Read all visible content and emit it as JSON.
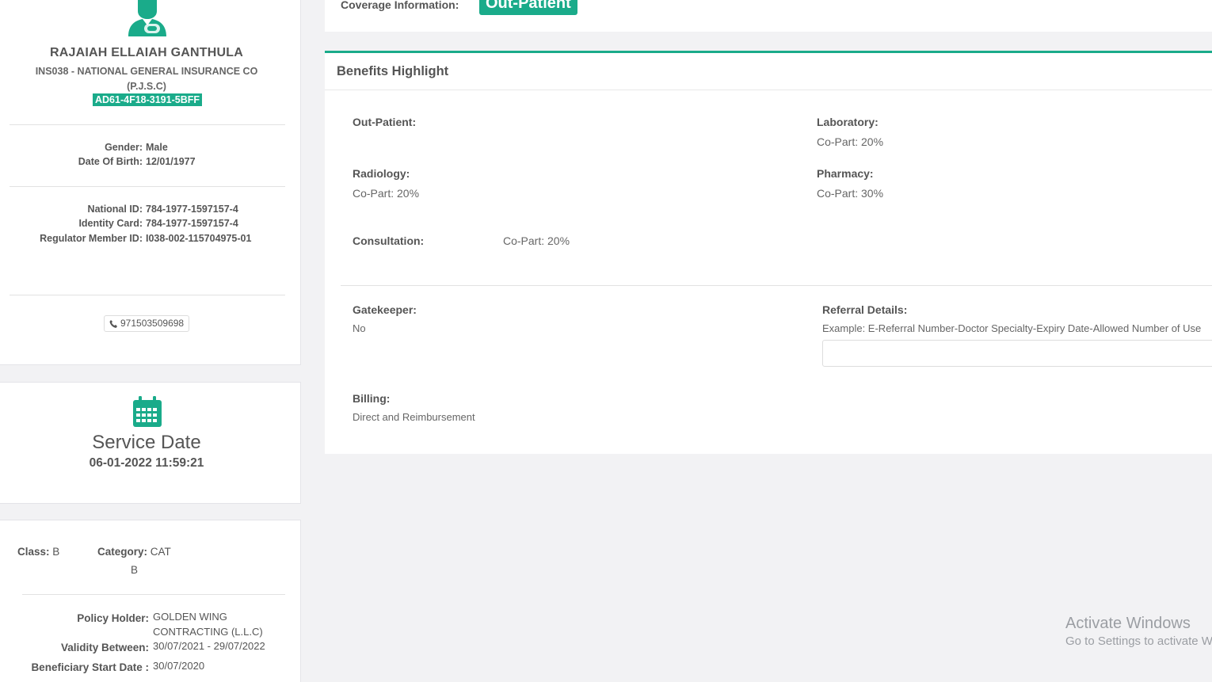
{
  "patient": {
    "avatar_icon": "user-avatar-icon",
    "name": "RAJAIAH ELLAIAH GANTHULA",
    "insurer": "INS038 - NATIONAL GENERAL INSURANCE CO (P.J.S.C)",
    "member_code": "AD61-4F18-3191-5BFF",
    "gender_label": "Gender:",
    "gender": "Male",
    "dob_label": "Date Of Birth:",
    "dob": "12/01/1977",
    "national_id_label": "National ID:",
    "national_id": "784-1977-1597157-4",
    "identity_card_label": "Identity Card:",
    "identity_card": "784-1977-1597157-4",
    "regulator_id_label": "Regulator Member ID:",
    "regulator_id": "I038-002-115704975-01",
    "phone_icon": "phone-icon",
    "phone": "971503509698"
  },
  "service": {
    "icon": "calendar-icon",
    "title": "Service Date",
    "datetime": "06-01-2022 11:59:21"
  },
  "policy": {
    "class_label": "Class:",
    "class_value": "B",
    "category_label": "Category:",
    "category_value_1": "CAT",
    "category_value_2": "B",
    "holder_label": "Policy Holder:",
    "holder_1": "GOLDEN WING",
    "holder_2": "CONTRACTING (L.L.C)",
    "validity_label": "Validity Between:",
    "validity": "30/07/2021 - 29/07/2022",
    "start_label": "Beneficiary Start Date :",
    "start": "30/07/2020"
  },
  "coverage": {
    "label": "Coverage Information:",
    "badge": "Out-Patient"
  },
  "benefits": {
    "title": "Benefits Highlight",
    "outpatient_label": "Out-Patient:",
    "laboratory_label": "Laboratory:",
    "laboratory_value": "Co-Part: 20%",
    "radiology_label": "Radiology:",
    "radiology_value": "Co-Part: 20%",
    "pharmacy_label": "Pharmacy:",
    "pharmacy_value": "Co-Part: 30%",
    "consultation_label": "Consultation:",
    "consultation_value": "Co-Part: 20%",
    "gatekeeper_label": "Gatekeeper:",
    "gatekeeper_value": "No",
    "referral_label": "Referral Details:",
    "referral_example": "Example: E-Referral Number-Doctor Specialty-Expiry Date-Allowed Number of Use",
    "referral_input_value": "",
    "billing_label": "Billing:",
    "billing_value": "Direct and Reimbursement"
  },
  "os_watermark": {
    "line1": "Activate Windows",
    "line2": "Go to Settings to activate Windows."
  },
  "colors": {
    "accent": "#1aab8a",
    "text": "#555555"
  }
}
